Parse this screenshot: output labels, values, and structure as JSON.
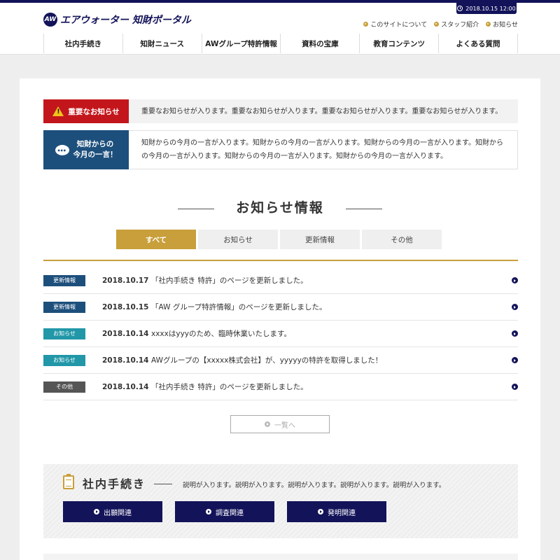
{
  "header": {
    "logo_mark": "AW",
    "logo_text": "エアウォーター 知財ポータル",
    "datetime": "2018.10.15 12:00",
    "toplinks": [
      "このサイトについて",
      "スタッフ紹介",
      "お知らせ"
    ]
  },
  "nav": [
    "社内手続き",
    "知財ニュース",
    "AWグループ特許情報",
    "資料の宝庫",
    "教育コンテンツ",
    "よくある質問"
  ],
  "notices": {
    "important_label": "重要なお知らせ",
    "important_text": "重要なお知らせが入ります。重要なお知らせが入ります。重要なお知らせが入ります。重要なお知らせが入ります。",
    "message_label_1": "知財からの",
    "message_label_2": "今月の一言！",
    "message_text": "知財からの今月の一言が入ります。知財からの今月の一言が入ります。知財からの今月の一言が入ります。知財からの今月の一言が入ります。知財からの今月の一言が入ります。知財からの今月の一言が入ります。"
  },
  "news": {
    "title": "お知らせ情報",
    "tabs": [
      "すべて",
      "お知らせ",
      "更新情報",
      "その他"
    ],
    "items": [
      {
        "badge": "更新情報",
        "type": "update",
        "date": "2018.10.17",
        "text": "「社内手続き 特許」のページを更新しました。"
      },
      {
        "badge": "更新情報",
        "type": "update",
        "date": "2018.10.15",
        "text": "「AW グループ特許情報」のページを更新しました。"
      },
      {
        "badge": "お知らせ",
        "type": "info",
        "date": "2018.10.14",
        "text": "xxxxはyyyのため、臨時休業いたします。"
      },
      {
        "badge": "お知らせ",
        "type": "info",
        "date": "2018.10.14",
        "text": "AWグループの【xxxxx株式会社】が、yyyyyの特許を取得しました！"
      },
      {
        "badge": "その他",
        "type": "other",
        "date": "2018.10.14",
        "text": "「社内手続き 特許」のページを更新しました。"
      }
    ],
    "more_label": "一覧へ"
  },
  "procedures": {
    "title": "社内手続き",
    "description": "説明が入ります。説明が入ります。説明が入ります。説明が入ります。説明が入ります。",
    "buttons": [
      "出願関連",
      "調査関連",
      "発明関連"
    ]
  },
  "colors": {
    "navy": "#13135a",
    "gold": "#c89f3a",
    "red": "#c3161c",
    "blue": "#1d4f7c",
    "teal": "#2197a8"
  }
}
